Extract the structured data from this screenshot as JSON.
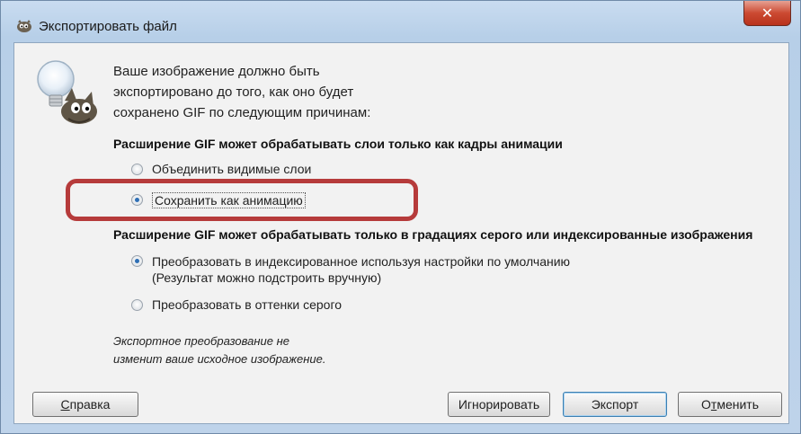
{
  "window": {
    "title": "Экспортировать файл",
    "close_glyph": "✕"
  },
  "intro": {
    "line1": "Ваше изображение должно быть",
    "line2": "экспортировано до того, как оно будет",
    "line3": "сохранено GIF по следующим причинам:"
  },
  "section1": {
    "title": "Расширение GIF может обрабатывать слои только как кадры анимации",
    "options": [
      {
        "label": "Объединить видимые слои",
        "checked": false
      },
      {
        "label": "Сохранить как анимацию",
        "checked": true
      }
    ]
  },
  "section2": {
    "title": "Расширение GIF может обрабатывать только в градациях серого или индексированные изображения",
    "options": [
      {
        "line1": "Преобразовать в индексированное используя настройки по умолчанию",
        "line2": "(Результат можно подстроить вручную)",
        "checked": true
      },
      {
        "label": "Преобразовать в оттенки серого",
        "checked": false
      }
    ]
  },
  "note": {
    "line1": "Экспортное преобразование не",
    "line2": "изменит ваше исходное изображение."
  },
  "buttons": {
    "help": {
      "mnemonic": "С",
      "rest": "правка"
    },
    "ignore": "Игнорировать",
    "export": "Экспорт",
    "cancel": {
      "before": "О",
      "mnemonic": "т",
      "rest": "менить"
    }
  },
  "colors": {
    "highlight": "#b63b3b",
    "radio_dot": "#2f6fb5"
  },
  "icons": {
    "title": "gimp-icon",
    "hint": "wilber-lightbulb-icon"
  }
}
